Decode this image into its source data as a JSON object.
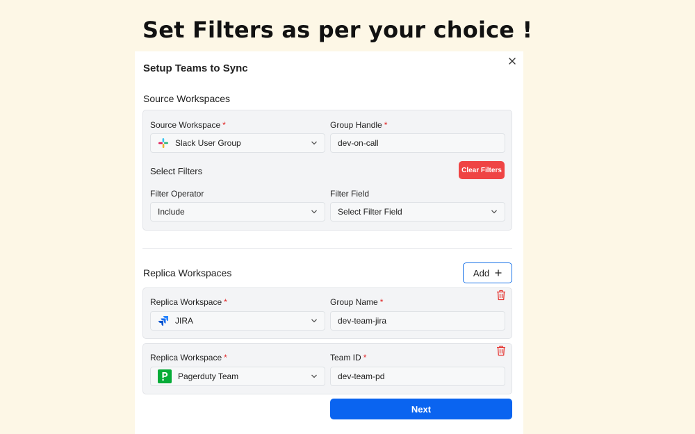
{
  "headline": "Set Filters as per your choice !",
  "dialog": {
    "title": "Setup Teams to Sync",
    "close_icon": "close-icon"
  },
  "source": {
    "section_title": "Source Workspaces",
    "workspace_label": "Source Workspace",
    "workspace_value": "Slack User Group",
    "workspace_icon": "slack-icon",
    "handle_label": "Group Handle",
    "handle_value": "dev-on-call",
    "required_mark": "*",
    "filters_title": "Select Filters",
    "clear_filters_label": "Clear Filters",
    "operator_label": "Filter Operator",
    "operator_value": "Include",
    "field_label": "Filter Field",
    "field_placeholder": "Select Filter Field"
  },
  "replica": {
    "section_title": "Replica Workspaces",
    "add_label": "Add",
    "add_icon": "plus-icon",
    "items": [
      {
        "workspace_label": "Replica Workspace",
        "workspace_value": "JIRA",
        "workspace_icon": "jira-icon",
        "id_label": "Group Name",
        "id_value": "dev-team-jira"
      },
      {
        "workspace_label": "Replica Workspace",
        "workspace_value": "Pagerduty Team",
        "workspace_icon": "pagerduty-icon",
        "id_label": "Team ID",
        "id_value": "dev-team-pd"
      }
    ]
  },
  "next_label": "Next",
  "colors": {
    "background": "#fdf7e6",
    "primary": "#0a64f0",
    "danger": "#ef4444",
    "required": "#e02424",
    "pagerduty": "#06ac38"
  }
}
